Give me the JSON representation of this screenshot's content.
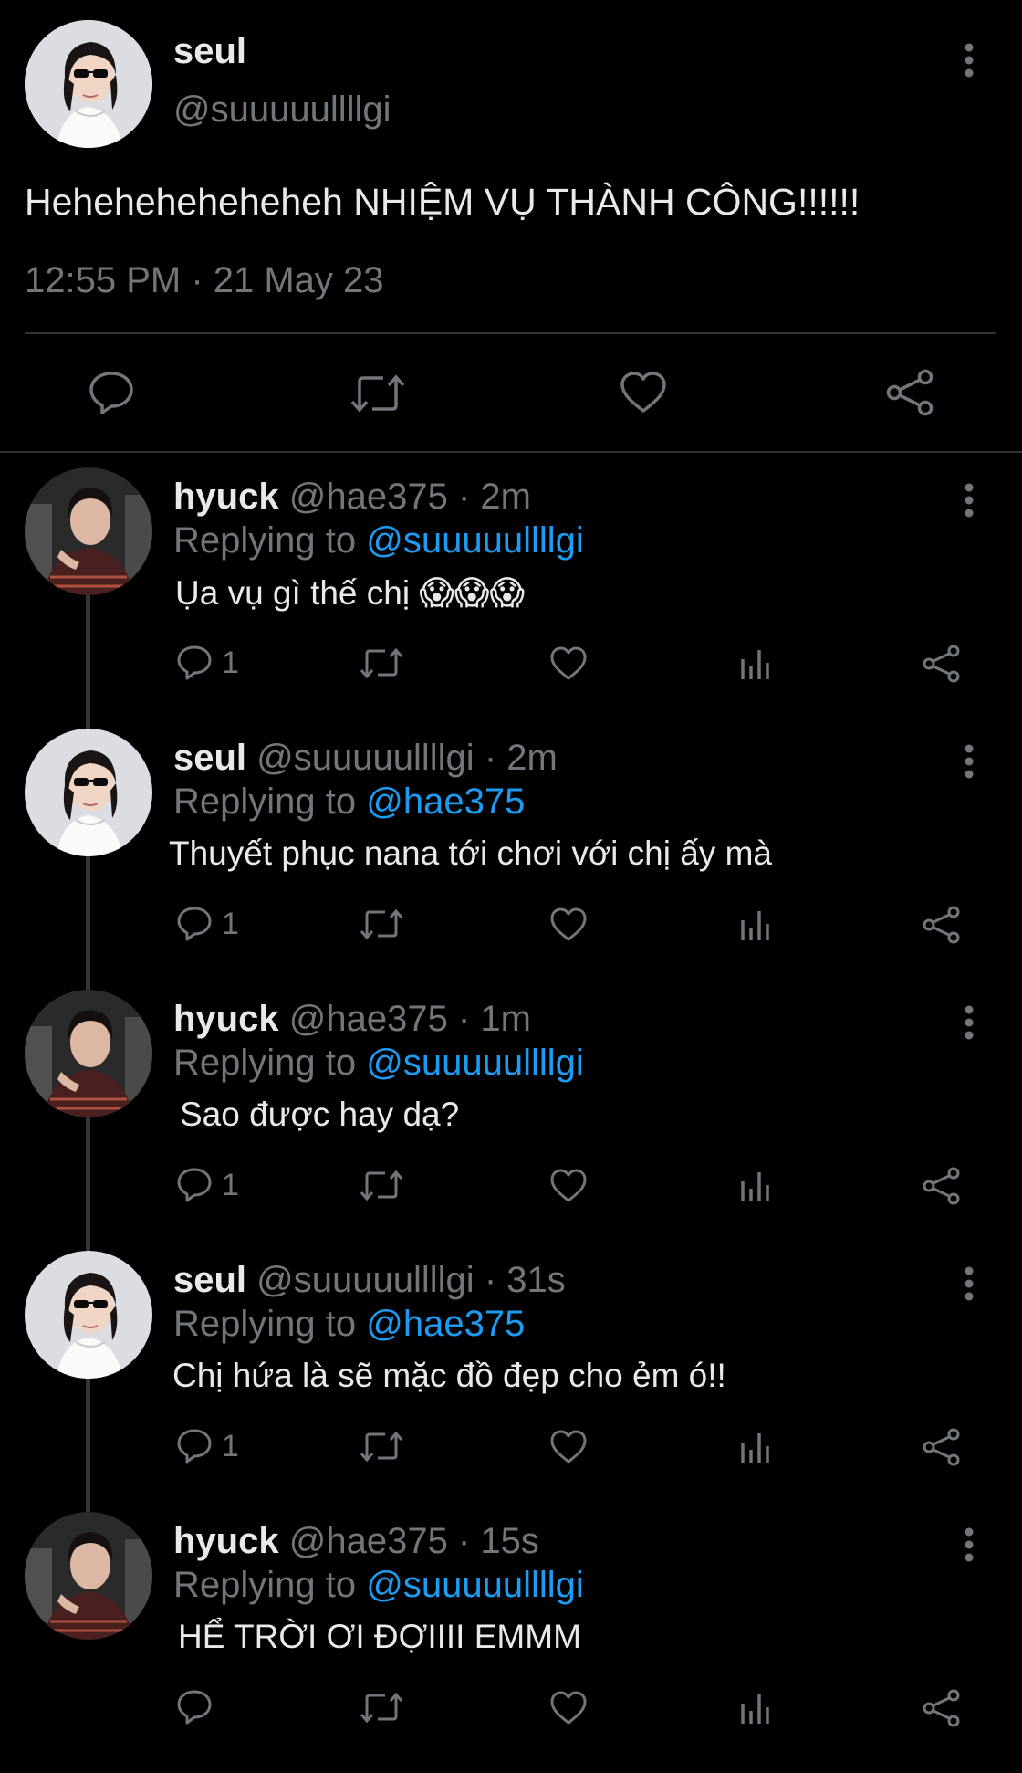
{
  "main_tweet": {
    "display_name": "seul",
    "handle": "@suuuuullllgi",
    "text": "Heheheheheheheh NHIỆM VỤ THÀNH CÔNG!!!!!!",
    "timestamp": "12:55 PM · 21 May 23",
    "actions": [
      "reply-icon",
      "retweet-icon",
      "like-icon",
      "share-icon"
    ]
  },
  "replies": [
    {
      "display_name": "hyuck",
      "handle": "@hae375",
      "time": "· 2m",
      "replying_prefix": "Replying to",
      "replying_to": "@suuuuullllgi",
      "text": "Ụa vụ gì thế chị 😱😱😱",
      "reply_count": "1"
    },
    {
      "display_name": "seul",
      "handle": "@suuuuullllgi",
      "time": "· 2m",
      "replying_prefix": "Replying to",
      "replying_to": "@hae375",
      "text": "Thuyết phục nana tới chơi với chị ấy mà",
      "reply_count": "1"
    },
    {
      "display_name": "hyuck",
      "handle": "@hae375",
      "time": "· 1m",
      "replying_prefix": "Replying to",
      "replying_to": "@suuuuullllgi",
      "text": "Sao được hay dạ?",
      "reply_count": "1"
    },
    {
      "display_name": "seul",
      "handle": "@suuuuullllgi",
      "time": "· 31s",
      "replying_prefix": "Replying to",
      "replying_to": "@hae375",
      "text": "Chị hứa là sẽ mặc đồ đẹp cho ẻm ó!!",
      "reply_count": "1"
    },
    {
      "display_name": "hyuck",
      "handle": "@hae375",
      "time": "· 15s",
      "replying_prefix": "Replying to",
      "replying_to": "@suuuuullllgi",
      "text": "HỂ TRỜI ƠI ĐỢIIII EMMM",
      "reply_count": ""
    }
  ],
  "colors": {
    "background": "#000000",
    "text": "#e7e9ea",
    "secondary": "#71767b",
    "link": "#1d9bf0",
    "divider": "#2f3336"
  }
}
